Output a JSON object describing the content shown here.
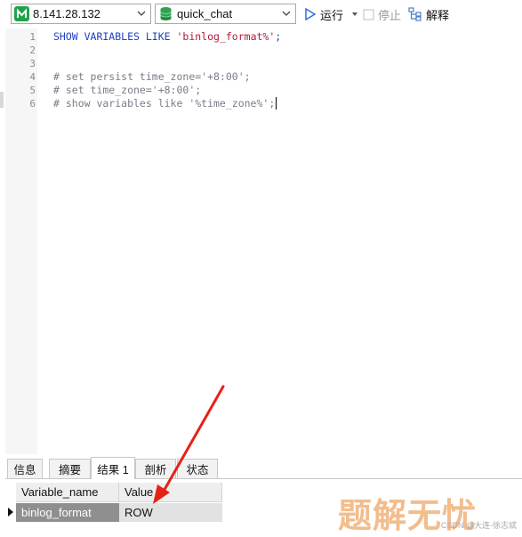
{
  "toolbar": {
    "connection": "8.141.28.132",
    "database": "quick_chat",
    "run_label": "运行",
    "stop_label": "停止",
    "explain_label": "解释"
  },
  "editor": {
    "lines": [
      {
        "num": "1",
        "parts": [
          {
            "t": "SHOW VARIABLES LIKE ",
            "c": "kw"
          },
          {
            "t": "'binlog_format%'",
            "c": "str"
          },
          {
            "t": ";",
            "c": "kw"
          }
        ]
      },
      {
        "num": "2",
        "parts": []
      },
      {
        "num": "3",
        "parts": []
      },
      {
        "num": "4",
        "parts": [
          {
            "t": "# set persist time_zone='+8:00';",
            "c": "cm"
          }
        ]
      },
      {
        "num": "5",
        "parts": [
          {
            "t": "# set time_zone='+8:00';",
            "c": "cm"
          }
        ]
      },
      {
        "num": "6",
        "parts": [
          {
            "t": "# show variables like '%time_zone%';",
            "c": "cm"
          }
        ]
      }
    ]
  },
  "result_tabs": [
    "信息",
    "摘要",
    "结果 1",
    "剖析",
    "状态"
  ],
  "active_tab": 2,
  "result": {
    "columns": [
      "Variable_name",
      "Value"
    ],
    "rows": [
      [
        "binlog_format",
        "ROW"
      ]
    ]
  },
  "watermark": {
    "text": "题解无忧",
    "credit": "CSDN @大连-徐志斌"
  },
  "colors": {
    "arrow": "#e62117",
    "keyword": "#1c3fc6",
    "string": "#b01b3a",
    "comment": "#7b7b8a"
  }
}
